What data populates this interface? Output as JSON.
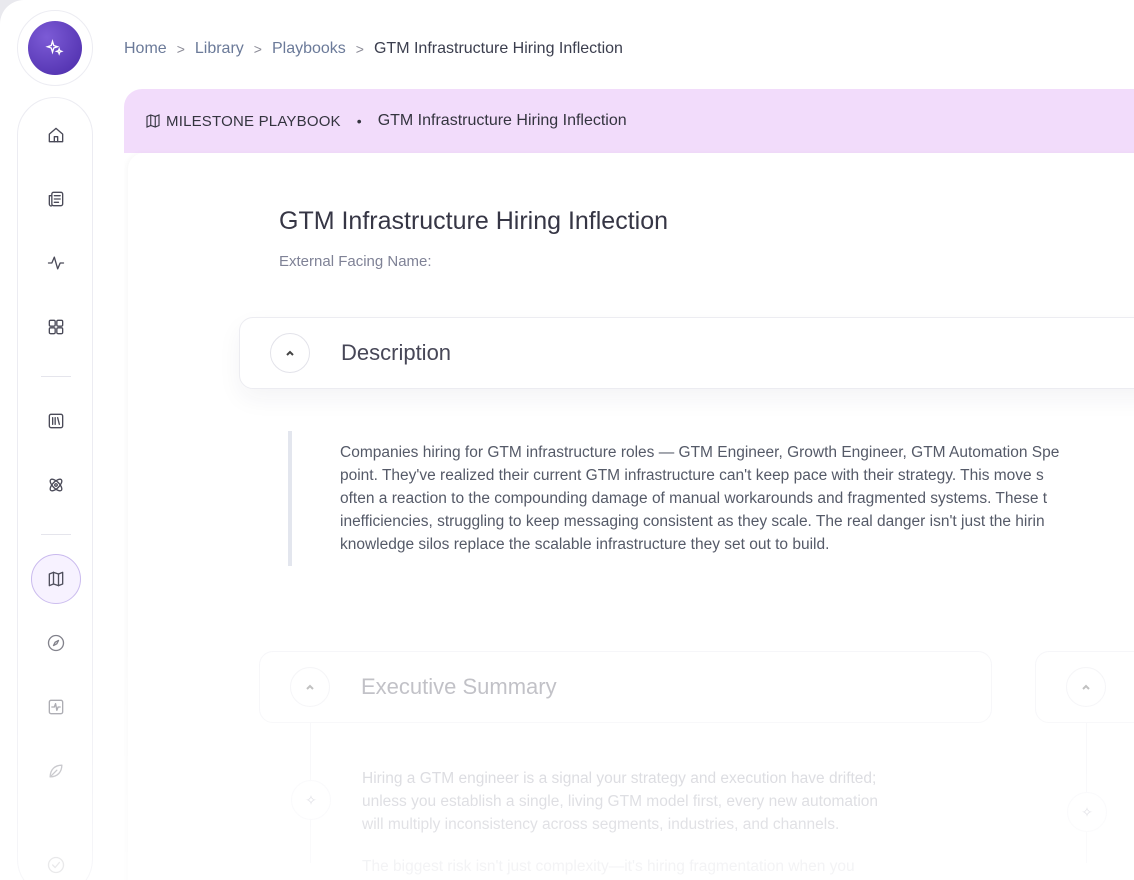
{
  "breadcrumb": {
    "home": "Home",
    "library": "Library",
    "playbooks": "Playbooks",
    "current": "GTM Infrastructure Hiring Inflection",
    "separator": ">"
  },
  "card_header": {
    "kind": "MILESTONE PLAYBOOK",
    "dot": "•",
    "title": "GTM Infrastructure Hiring Inflection"
  },
  "page": {
    "title": "GTM Infrastructure Hiring Inflection",
    "subtitle": "External Facing Name:"
  },
  "description": {
    "heading": "Description",
    "lines": [
      "Companies hiring for GTM infrastructure roles — GTM Engineer, Growth Engineer, GTM Automation Spe",
      "point. They've realized their current GTM infrastructure can't keep pace with their strategy. This move s",
      "often a reaction to the compounding damage of manual workarounds and fragmented systems. These t",
      "inefficiencies, struggling to keep messaging consistent as they scale. The real danger isn't just the hirin",
      "knowledge silos replace the scalable infrastructure they set out to build."
    ]
  },
  "executive_summary": {
    "heading": "Executive Summary",
    "lines": [
      "Hiring a GTM engineer is a signal your strategy and execution have drifted;",
      "unless you establish a single, living GTM model first, every new automation",
      "will multiply inconsistency across segments, industries, and channels."
    ],
    "trailing_line": "The biggest risk isn't just complexity—it's hiring fragmentation when you"
  },
  "sidebar": {
    "icons": [
      "home-icon",
      "newspaper-icon",
      "activity-icon",
      "grid-icon",
      "library-icon",
      "atom-icon",
      "map-icon",
      "compass-icon",
      "pulse-icon",
      "leaf-icon",
      "check-circle-icon"
    ],
    "active": "map-icon"
  },
  "colors": {
    "accent": "#5a37b8",
    "header_bg": "#f2dcfb",
    "active_border": "#c9b9ee"
  }
}
